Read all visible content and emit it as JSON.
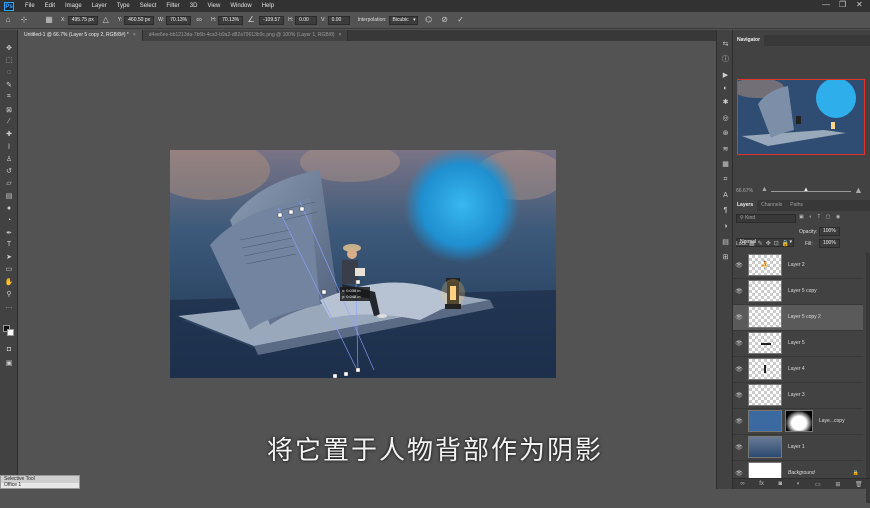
{
  "app": {
    "logo": "Ps"
  },
  "menu": [
    "File",
    "Edit",
    "Image",
    "Layer",
    "Type",
    "Select",
    "Filter",
    "3D",
    "View",
    "Window",
    "Help"
  ],
  "window_controls": {
    "minimize": "—",
    "restore": "❐",
    "close": "✕"
  },
  "options": {
    "x_label": "X:",
    "x_value": "495.75 px",
    "y_label": "Y:",
    "y_value": "460.50 px",
    "w_label": "W:",
    "w_value": "70.13%",
    "h_label": "H:",
    "h_value": "70.13%",
    "angle_value": "-109.57",
    "hskew_label": "H:",
    "hskew_value": "0.00",
    "vskew_label": "V:",
    "vskew_value": "0.00",
    "interp_label": "Interpolation:",
    "interp_value": "Bicubic"
  },
  "tabs": [
    {
      "label": "Untitled-1 @ 66.7% (Layer 5 copy 2, RGB/8#) *",
      "close": "×"
    },
    {
      "label": "d4ee6ee-bb1213da-7b6b-4ca3-b9a2-d82a79613b9c.png @ 100% (Layer 1, RGB/8)",
      "close": "×"
    }
  ],
  "transform_readout": {
    "line1": "x: 0.035 in",
    "line2": "y: 0.048 in"
  },
  "subtitle": "将它置于人物背部作为阴影",
  "navigator": {
    "tab": "Navigator",
    "zoom": "66.67%"
  },
  "layers_panel": {
    "tabs": [
      "Layers",
      "Channels",
      "Paths"
    ],
    "kind_placeholder": "Kind",
    "blend_mode": "Normal",
    "opacity_label": "Opacity:",
    "opacity_value": "100%",
    "lock_label": "Lock:",
    "fill_label": "Fill:",
    "fill_value": "100%",
    "layers": [
      {
        "name": "Layer 2"
      },
      {
        "name": "Layer 5 copy"
      },
      {
        "name": "Layer 5 copy 2",
        "selected": true
      },
      {
        "name": "Layer 5"
      },
      {
        "name": "Layer 4"
      },
      {
        "name": "Layer 3"
      },
      {
        "name": "Laye...copy"
      },
      {
        "name": "Layer 1"
      },
      {
        "name": "Background"
      }
    ]
  },
  "status_panel": {
    "title": "Selective Tool",
    "value": "Office 1"
  },
  "colors": {
    "accent": "#31a8ff",
    "nav_frame": "#e2332c",
    "panel": "#424242",
    "workspace": "#535353"
  }
}
